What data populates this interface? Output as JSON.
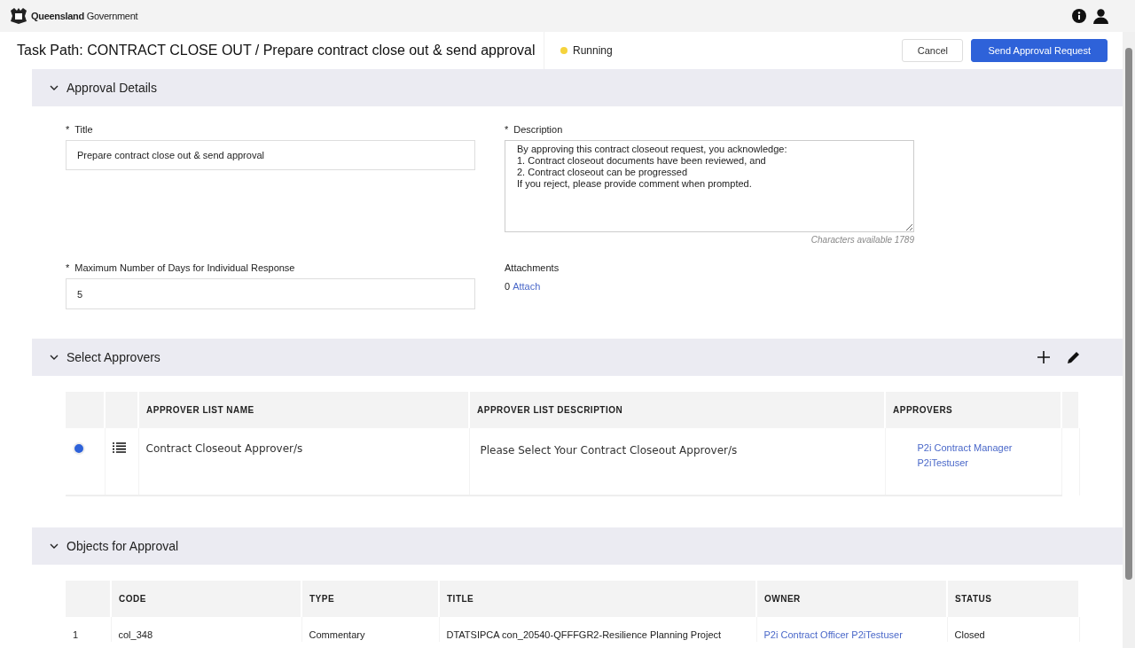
{
  "brand": {
    "name": "Queensland",
    "suffix": "Government"
  },
  "header": {
    "title": "Task Path: CONTRACT CLOSE OUT / Prepare contract close out & send approval",
    "status": {
      "label": "Running",
      "color": "#f5d33c"
    },
    "buttons": [
      {
        "label": "Cancel",
        "kind": "secondary"
      },
      {
        "label": "Send Approval Request",
        "kind": "primary"
      }
    ]
  },
  "approval_details": {
    "heading": "Approval Details",
    "expanded": true,
    "title_field": {
      "label": "Title",
      "required_mark": "*",
      "value": "Prepare contract close out & send approval"
    },
    "description_field": {
      "label": "Description",
      "required_mark": "*",
      "value": "By approving this contract closeout request, you acknowledge:\n1. Contract closeout documents have been reviewed, and\n2. Contract closeout can be progressed\nIf you reject, please provide comment when prompted.",
      "counter": "Characters available 1789"
    },
    "days_field": {
      "label": "Maximum Number of Days for Individual Response",
      "required_mark": "*",
      "value": "5"
    },
    "attachments": {
      "label": "Attachments",
      "count": "0",
      "link": "Attach"
    }
  },
  "select_approvers": {
    "heading": "Select Approvers",
    "expanded": true,
    "columns": [
      "APPROVER LIST NAME",
      "APPROVER LIST DESCRIPTION",
      "APPROVERS"
    ],
    "rows": [
      {
        "selected": true,
        "name": "Contract Closeout Approver/s",
        "description": "Please Select Your Contract Closeout Approver/s",
        "approvers": "P2i Contract Manager P2iTestuser"
      }
    ]
  },
  "objects_for_approval": {
    "heading": "Objects for Approval",
    "expanded": true,
    "columns": [
      "CODE",
      "TYPE",
      "TITLE",
      "OWNER",
      "STATUS"
    ],
    "rows": [
      {
        "index": "1",
        "code": "col_348",
        "type": "Commentary",
        "title": "DTATSIPCA con_20540-QFFFGR2-Resilience Planning Project",
        "owner": "P2i Contract Officer P2iTestuser",
        "status": "Closed"
      }
    ]
  }
}
